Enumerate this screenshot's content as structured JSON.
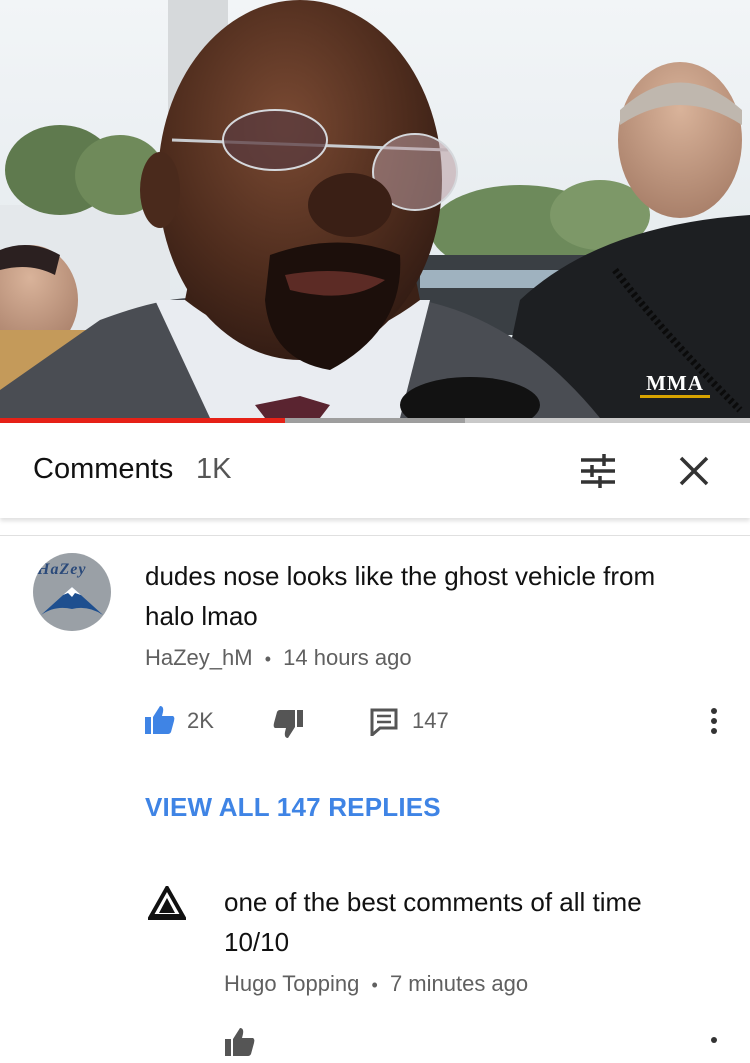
{
  "video": {
    "logo_text": "MMA",
    "progress": 0.38,
    "buffered": 0.62
  },
  "header": {
    "title": "Comments",
    "count": "1K",
    "sort_icon": "sort-filter-icon",
    "close_icon": "close-icon"
  },
  "comments": [
    {
      "avatar_text": "HaZey",
      "text_line1": "dudes nose looks like the ghost vehicle from",
      "text_line2": "halo lmao",
      "author": "HaZey_hM",
      "separator": "•",
      "time": "14 hours ago",
      "likes": "2K",
      "replies_count": "147",
      "view_replies": "VIEW ALL 147 REPLIES"
    },
    {
      "text_line1": "one of the best comments of all time",
      "text_line2": "10/10",
      "author": "Hugo Topping",
      "separator": "•",
      "time": "7 minutes ago"
    }
  ],
  "colors": {
    "accent_blue": "#3f84e5",
    "progress_red": "#e62117",
    "meta_gray": "#606060"
  }
}
